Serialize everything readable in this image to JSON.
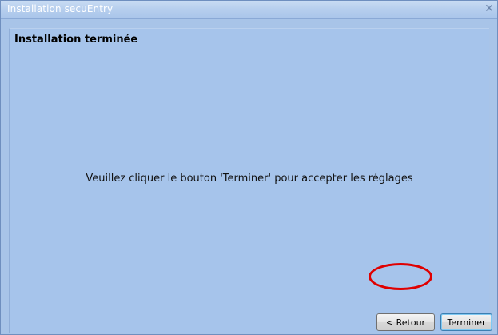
{
  "window": {
    "title": "Installation secuEntry",
    "close_symbol": "✕"
  },
  "page": {
    "header": "Installation terminée",
    "message": "Veuillez cliquer le bouton 'Terminer' pour accepter les réglages"
  },
  "buttons": {
    "back_label": "< Retour",
    "finish_label": "Terminer"
  },
  "colors": {
    "background": "#a8c4e8",
    "annotation": "#e00000"
  }
}
